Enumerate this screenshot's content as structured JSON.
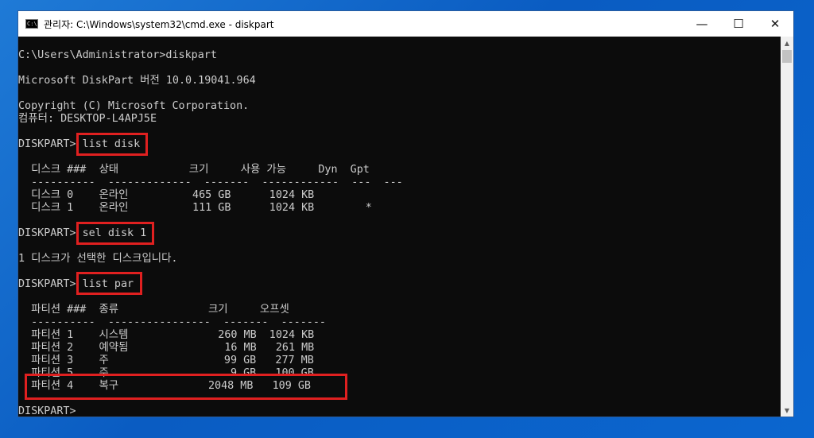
{
  "window": {
    "title": "관리자: C:\\Windows\\system32\\cmd.exe - diskpart",
    "icon": "cmd-icon",
    "controls": {
      "minimize": "—",
      "maximize": "☐",
      "close": "✕"
    }
  },
  "console": {
    "lines": [
      "C:\\Users\\Administrator>diskpart",
      "",
      "Microsoft DiskPart 버전 10.0.19041.964",
      "",
      "Copyright (C) Microsoft Corporation.",
      "컴퓨터: DESKTOP-L4APJ5E",
      "",
      "DISKPART> list disk",
      "",
      "  디스크 ###  상태           크기     사용 가능     Dyn  Gpt",
      "  ----------  -------------  -------  ------------  ---  ---",
      "  디스크 0    온라인          465 GB      1024 KB",
      "  디스크 1    온라인          111 GB      1024 KB        *",
      "",
      "DISKPART> sel disk 1",
      "",
      "1 디스크가 선택한 디스크입니다.",
      "",
      "DISKPART> list par",
      "",
      "  파티션 ###  종류              크기     오프셋",
      "  ----------  ----------------  -------  -------",
      "  파티션 1    시스템              260 MB  1024 KB",
      "  파티션 2    예약됨               16 MB   261 MB",
      "  파티션 3    주                  99 GB   277 MB",
      "  파티션 5    주                   9 GB   100 GB",
      "  파티션 4    복구              2048 MB   109 GB",
      "",
      "DISKPART>"
    ]
  },
  "highlights": [
    "list disk",
    "sel disk 1",
    "list par",
    "파티션 4 복구 2048 MB 109 GB"
  ]
}
